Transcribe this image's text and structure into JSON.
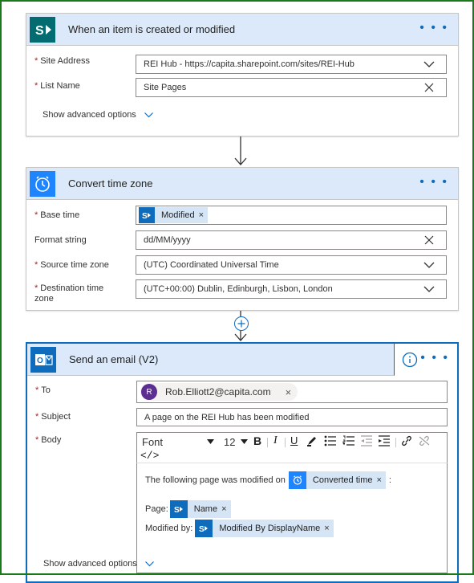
{
  "trigger": {
    "title": "When an item is created or modified",
    "icon": "sharepoint-icon",
    "fields": [
      {
        "label": "Site Address",
        "required": true,
        "value": "REI Hub - https://capita.sharepoint.com/sites/REI-Hub"
      },
      {
        "label": "List Name",
        "required": true,
        "value": "Site Pages"
      }
    ],
    "advanced": "Show advanced options"
  },
  "convert": {
    "title": "Convert time zone",
    "icon": "alarm-clock-icon",
    "fields": [
      {
        "label": "Base time",
        "required": true,
        "token": "Modified"
      },
      {
        "label": "Format string",
        "required": false,
        "value": "dd/MM/yyyy"
      },
      {
        "label": "Source time zone",
        "required": true,
        "value": "(UTC) Coordinated Universal Time"
      },
      {
        "label": "Destination time zone",
        "required": true,
        "value": "(UTC+00:00) Dublin, Edinburgh, Lisbon, London"
      }
    ]
  },
  "email": {
    "title": "Send an email (V2)",
    "icon": "outlook-icon",
    "to_label": "To",
    "to_avatar": "R",
    "to_value": "Rob.Elliott2@capita.com",
    "subject_label": "Subject",
    "subject_value": "A page on the REI Hub has been modified",
    "body_label": "Body",
    "toolbar": {
      "font": "Font",
      "size": "12",
      "bold": "B",
      "italic": "I",
      "underline": "U",
      "code": "</>"
    },
    "body": {
      "line1": "The following page was modified on",
      "token1": "Converted time",
      "colon": ":",
      "page_label": "Page:",
      "token2": "Name",
      "modified_label": "Modified by:",
      "token3": "Modified By DisplayName"
    },
    "advanced": "Show advanced options"
  },
  "required_mark": "*",
  "colors": {
    "accent": "#0f6cbd",
    "header": "#dbe9fa",
    "frame": "#1a7a1a",
    "required": "#a4262c"
  }
}
